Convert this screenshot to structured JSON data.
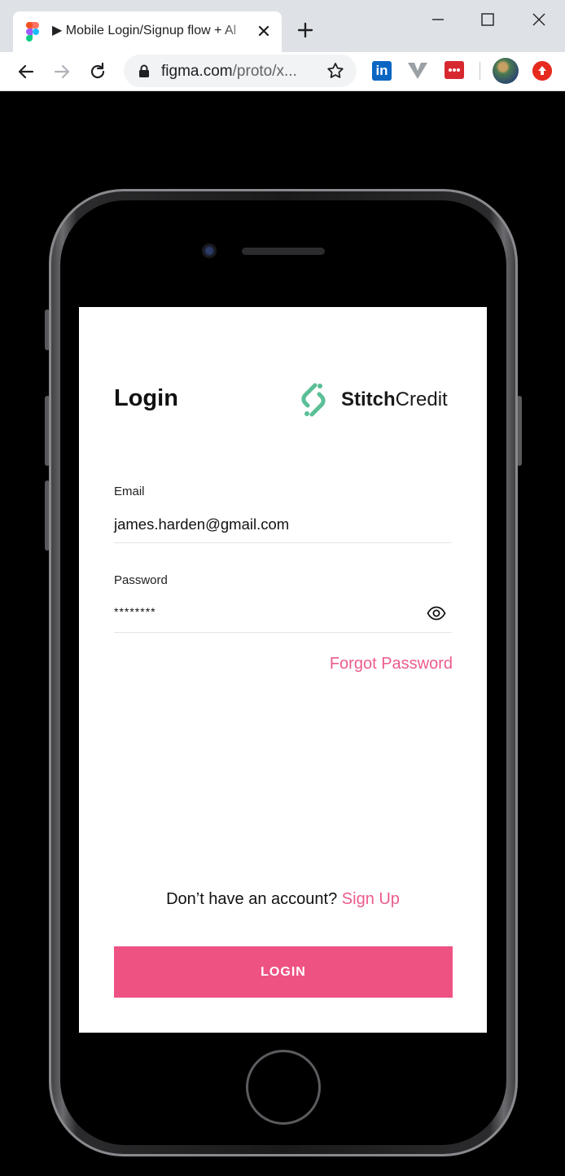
{
  "browser": {
    "tab_title": "▶ Mobile Login/Signup flow + Al",
    "url_host": "figma.com",
    "url_path": "/proto/x...",
    "extensions": {
      "linkedin_label": "in"
    }
  },
  "screen": {
    "title": "Login",
    "brand": {
      "name_bold": "Stitch",
      "name_regular": "Credit",
      "logo_color": "#5bbf96"
    },
    "email": {
      "label": "Email",
      "value": "james.harden@gmail.com"
    },
    "password": {
      "label": "Password",
      "value": "********"
    },
    "forgot_password": "Forgot Password",
    "signup_prompt": "Don’t have an account?",
    "signup_link": "Sign Up",
    "login_button": "LOGIN",
    "accent_color": "#ee5283"
  }
}
